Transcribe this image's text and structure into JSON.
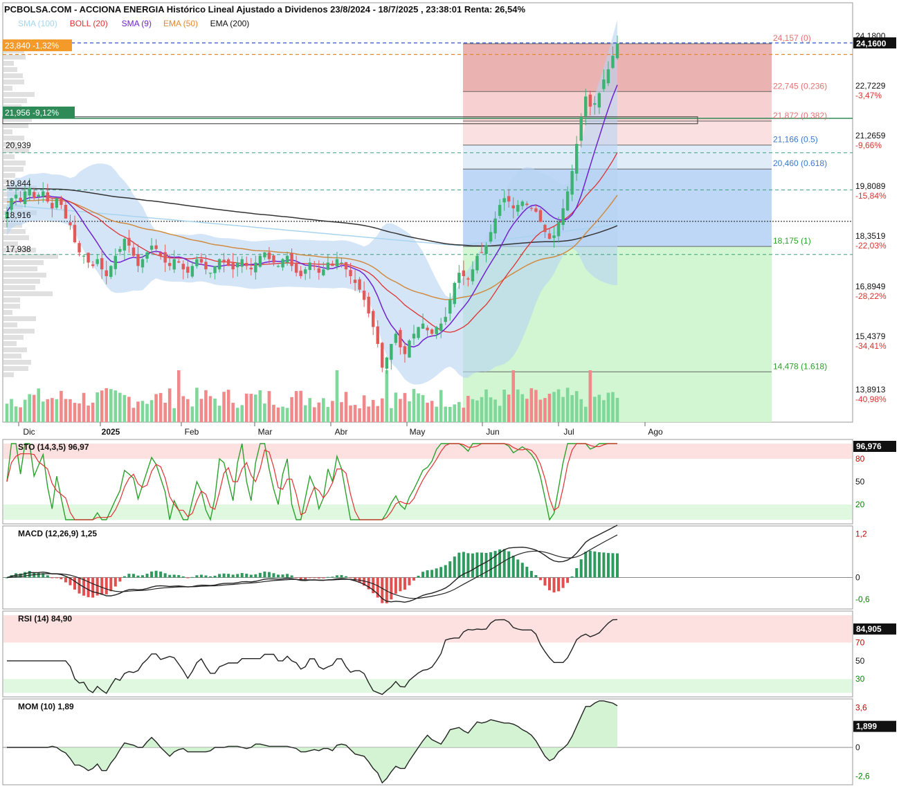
{
  "header": {
    "title": "PCBOLSA.COM - ACCIONA ENERGIA Histórico Lineal Ajustado a Dividenos 23/8/2024 - 18/7/2025 , 23:38:01 Renta: 26,54%"
  },
  "legend": [
    {
      "label": "SMA (100)",
      "color": "#a8d4f0"
    },
    {
      "label": "BOLL (20)",
      "color": "#e03030"
    },
    {
      "label": "SMA (9)",
      "color": "#7020d0"
    },
    {
      "label": "EMA (50)",
      "color": "#e08a30"
    },
    {
      "label": "EMA (200)",
      "color": "#111111"
    }
  ],
  "colors": {
    "up": "#3cb371",
    "down": "#e05a5a",
    "vol_up": "#7fd79a",
    "vol_down": "#f08a8a",
    "boll_fill": "#b8d4f4",
    "sma9": "#7020d0",
    "boll": "#e03030",
    "ema50": "#d08a40",
    "ema200": "#333333",
    "sma100": "#a8d4f0"
  },
  "price_axis": {
    "ticks": [
      "24,1800",
      "22,7229",
      "21,2659",
      "19,8089",
      "18,3519",
      "16,8949",
      "15,4379",
      "13,8913"
    ],
    "pct": [
      "",
      "-3,47%",
      "-9,66%",
      "-15,84%",
      "-22,03%",
      "-28,22%",
      "-34,41%",
      "-40,98%"
    ],
    "last_price": "24,1600"
  },
  "left_labels": [
    {
      "text": "23,840  -1,32%",
      "kind": "orange"
    },
    {
      "text": "21,956  -9,12%",
      "kind": "green"
    },
    {
      "text": "20,939",
      "kind": "plain"
    },
    {
      "text": "19,844",
      "kind": "plain"
    },
    {
      "text": "18,916",
      "kind": "plain"
    },
    {
      "text": "17,938",
      "kind": "plain"
    }
  ],
  "fibonacci": [
    {
      "label": "24,157 (0)",
      "value": 24.157,
      "color": "#e87070"
    },
    {
      "label": "22,745 (0.236)",
      "value": 22.745,
      "color": "#e87070"
    },
    {
      "label": "21,872 (0.382)",
      "value": 21.872,
      "color": "#e87070"
    },
    {
      "label": "21,166 (0.5)",
      "value": 21.166,
      "color": "#3a78d0"
    },
    {
      "label": "20,460 (0.618)",
      "value": 20.46,
      "color": "#3a78d0"
    },
    {
      "label": "18,175 (1)",
      "value": 18.175,
      "color": "#2ca02c"
    },
    {
      "label": "14,478 (1.618)",
      "value": 14.478,
      "color": "#2ca02c"
    }
  ],
  "x_axis": {
    "labels": [
      "Dic",
      "2025",
      "Feb",
      "Mar",
      "Abr",
      "May",
      "Jun",
      "Jul",
      "Ago"
    ]
  },
  "chart_data": {
    "type": "candlestick",
    "title": "PCBOLSA.COM - ACCIONA ENERGIA Histórico Lineal Ajustado a Dividenos 23/8/2024 - 18/7/2025 , 23:38:01 Renta: 26,54%",
    "ylim": [
      13.6,
      24.7
    ],
    "close": [
      19.2,
      19.6,
      19.7,
      19.5,
      19.8,
      19.9,
      19.6,
      19.7,
      19.8,
      19.5,
      19.3,
      19.6,
      19.4,
      19.0,
      18.8,
      18.3,
      18.0,
      17.9,
      17.7,
      17.6,
      17.8,
      17.5,
      17.3,
      17.6,
      17.9,
      18.1,
      18.4,
      18.2,
      17.9,
      17.6,
      17.8,
      18.0,
      18.2,
      18.1,
      17.9,
      17.7,
      17.6,
      17.8,
      17.7,
      17.5,
      17.4,
      17.6,
      17.8,
      17.7,
      17.5,
      17.4,
      17.6,
      17.8,
      17.7,
      17.6,
      17.5,
      17.7,
      17.8,
      17.6,
      17.5,
      17.7,
      17.9,
      18.0,
      17.8,
      17.7,
      17.6,
      17.8,
      17.9,
      17.6,
      17.4,
      17.3,
      17.5,
      17.7,
      17.6,
      17.4,
      17.5,
      17.7,
      17.6,
      17.8,
      17.7,
      17.5,
      17.3,
      17.1,
      16.9,
      16.6,
      16.2,
      15.8,
      15.3,
      14.6,
      14.9,
      15.3,
      15.6,
      15.2,
      15.0,
      15.4,
      15.6,
      15.8,
      15.9,
      15.7,
      15.6,
      15.8,
      15.9,
      16.1,
      16.6,
      17.1,
      17.4,
      17.3,
      17.2,
      17.5,
      17.9,
      18.0,
      18.2,
      18.6,
      19.0,
      19.4,
      19.6,
      19.5,
      19.3,
      19.4,
      19.5,
      19.4,
      19.3,
      19.2,
      18.9,
      18.6,
      18.4,
      18.5,
      18.9,
      19.3,
      19.8,
      20.4,
      21.2,
      22.0,
      22.6,
      22.3,
      22.4,
      22.7,
      23.1,
      23.4,
      23.8,
      24.16
    ],
    "series": [
      {
        "name": "SMA (9)"
      },
      {
        "name": "BOLL (20)"
      },
      {
        "name": "EMA (50)"
      },
      {
        "name": "EMA (200)"
      },
      {
        "name": "SMA (100)"
      }
    ]
  },
  "panels": [
    {
      "name": "STO (14,3,5)",
      "value": "96,97",
      "last": "96,976",
      "ticks": [
        "80",
        "50",
        "20"
      ]
    },
    {
      "name": "MACD (12,26,9)",
      "value": "1,25",
      "ticks": [
        "1,2",
        "0",
        "-0,6"
      ]
    },
    {
      "name": "RSI (14)",
      "value": "84,90",
      "last": "84,905",
      "ticks": [
        "70",
        "50",
        "30"
      ]
    },
    {
      "name": "MOM (10)",
      "value": "1,89",
      "last": "1,899",
      "ticks": [
        "3,6",
        "0",
        "-2,6"
      ]
    }
  ]
}
